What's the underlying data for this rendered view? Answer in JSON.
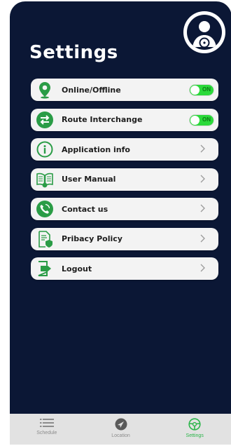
{
  "screen": {
    "title": "Settings"
  },
  "settings": [
    {
      "label": "Online/Offline",
      "icon": "location-pin-icon",
      "control": "toggle",
      "toggle_text": "ON"
    },
    {
      "label": "Route Interchange",
      "icon": "swap-arrows-icon",
      "control": "toggle",
      "toggle_text": "ON"
    },
    {
      "label": "Application info",
      "icon": "info-icon",
      "control": "chevron"
    },
    {
      "label": "User Manual",
      "icon": "book-icon",
      "control": "chevron"
    },
    {
      "label": "Contact us",
      "icon": "phone-icon",
      "control": "chevron"
    },
    {
      "label": "Pribacy Policy",
      "icon": "policy-document-icon",
      "control": "chevron"
    },
    {
      "label": "Logout",
      "icon": "logout-icon",
      "control": "chevron"
    }
  ],
  "tabbar": {
    "tabs": [
      {
        "label": "Schedule",
        "icon": "list-icon",
        "active": false
      },
      {
        "label": "Location",
        "icon": "navigation-icon",
        "active": false
      },
      {
        "label": "Settings",
        "icon": "steering-wheel-icon",
        "active": true
      }
    ]
  },
  "colors": {
    "background": "#0b1735",
    "accent": "#2bb54a",
    "row": "#f3f3f3"
  }
}
